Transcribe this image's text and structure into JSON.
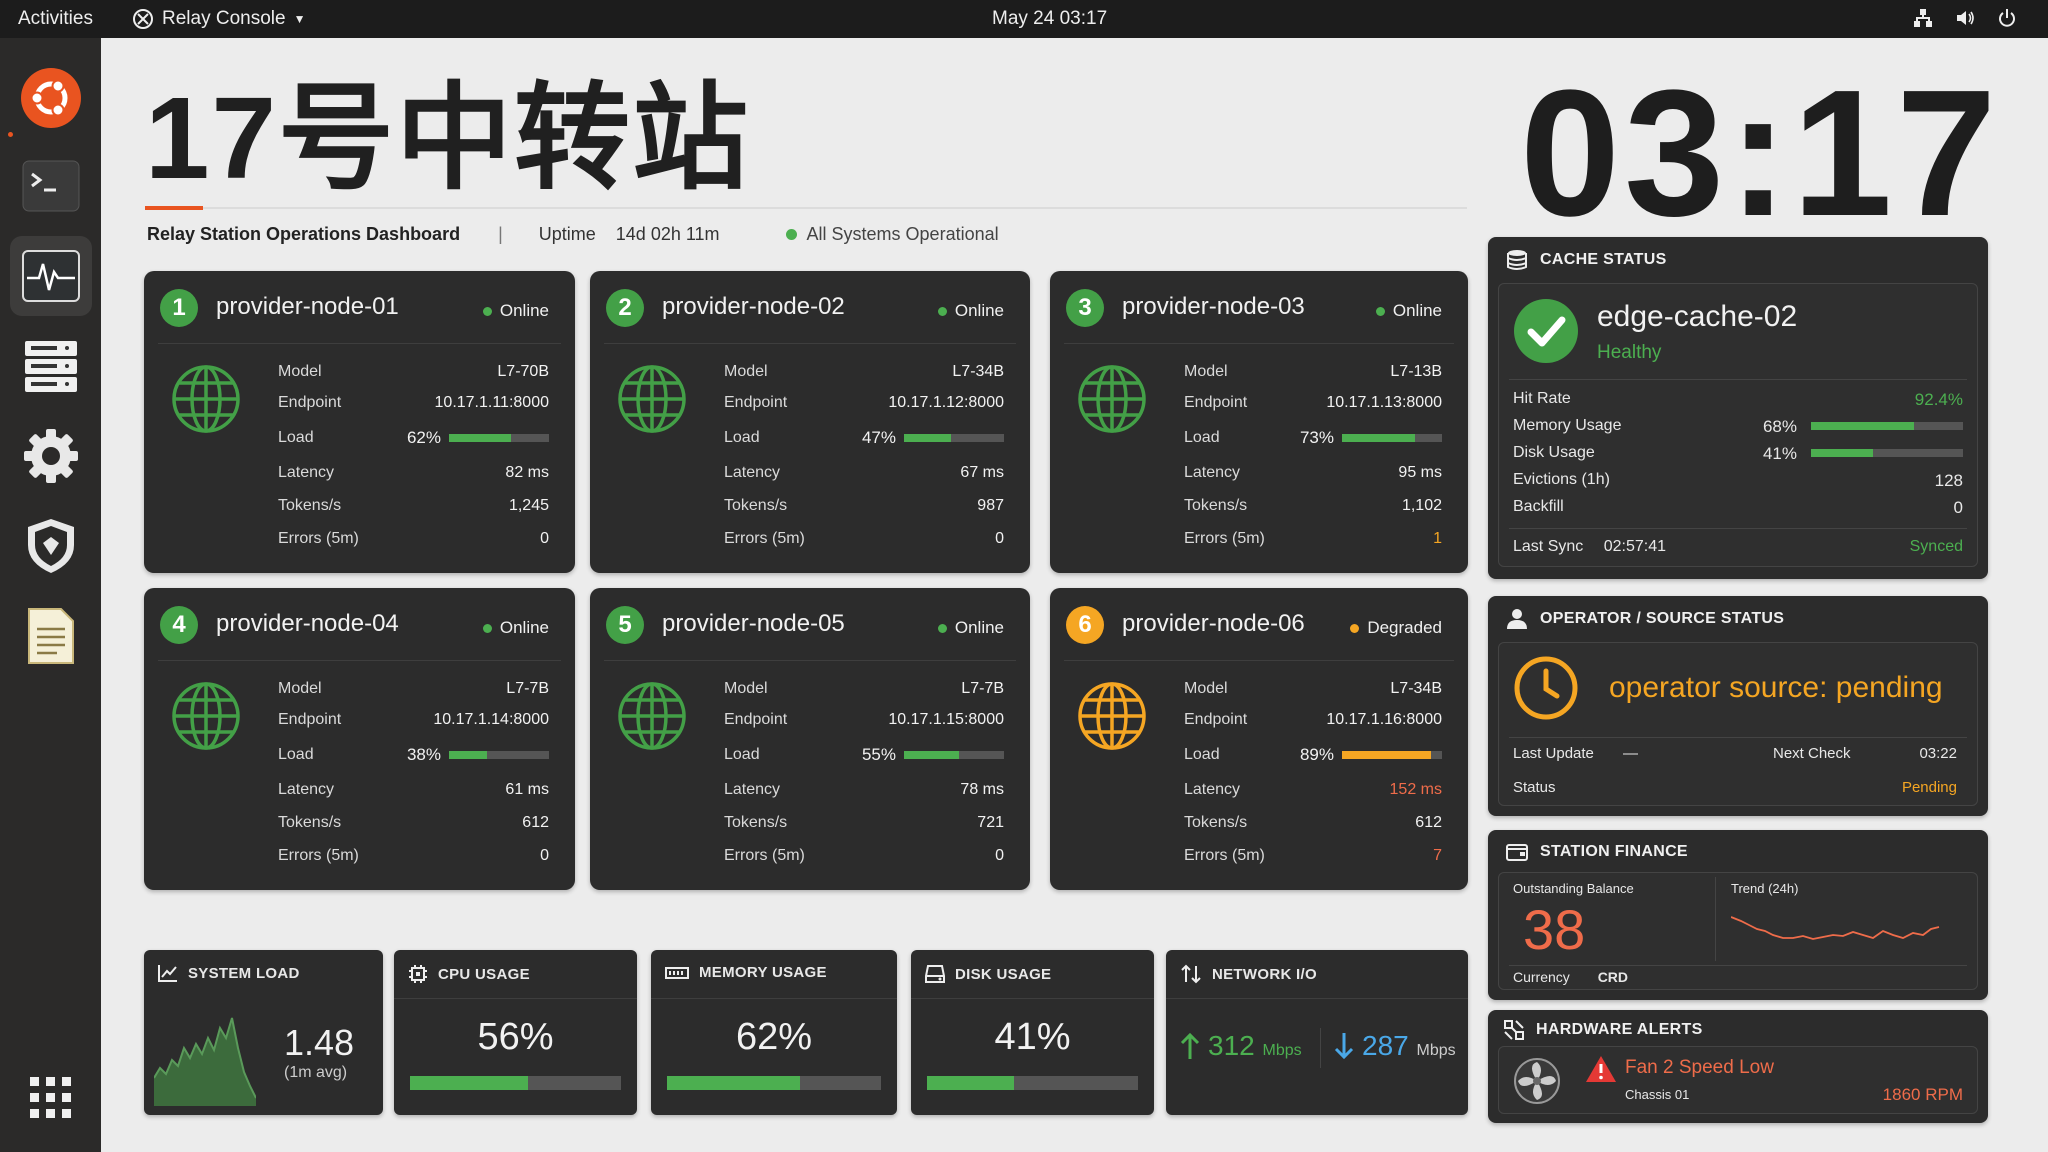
{
  "topbar": {
    "activities": "Activities",
    "app_name": "Relay Console",
    "datetime": "May 24  03:17"
  },
  "header": {
    "title": "17号中转站",
    "subtitle": "Relay Station Operations Dashboard",
    "separator": "|",
    "uptime_label": "Uptime",
    "uptime_value": "14d 02h 11m",
    "system_status": "All Systems Operational",
    "clock": "03:17"
  },
  "nodes": [
    {
      "num": "1",
      "name": "provider-node-01",
      "status": "Online",
      "model": "L7-70B",
      "endpoint": "10.17.1.11:8000",
      "load": "62%",
      "load_frac": 0.62,
      "latency": "82 ms",
      "tokens": "1,245",
      "errors": "0"
    },
    {
      "num": "2",
      "name": "provider-node-02",
      "status": "Online",
      "model": "L7-34B",
      "endpoint": "10.17.1.12:8000",
      "load": "47%",
      "load_frac": 0.47,
      "latency": "67 ms",
      "tokens": "987",
      "errors": "0"
    },
    {
      "num": "3",
      "name": "provider-node-03",
      "status": "Online",
      "model": "L7-13B",
      "endpoint": "10.17.1.13:8000",
      "load": "73%",
      "load_frac": 0.73,
      "latency": "95 ms",
      "tokens": "1,102",
      "errors": "1"
    },
    {
      "num": "4",
      "name": "provider-node-04",
      "status": "Online",
      "model": "L7-7B",
      "endpoint": "10.17.1.14:8000",
      "load": "38%",
      "load_frac": 0.38,
      "latency": "61 ms",
      "tokens": "612",
      "errors": "0"
    },
    {
      "num": "5",
      "name": "provider-node-05",
      "status": "Online",
      "model": "L7-7B",
      "endpoint": "10.17.1.15:8000",
      "load": "55%",
      "load_frac": 0.55,
      "latency": "78 ms",
      "tokens": "721",
      "errors": "0"
    },
    {
      "num": "6",
      "name": "provider-node-06",
      "status": "Degraded",
      "model": "L7-34B",
      "endpoint": "10.17.1.16:8000",
      "load": "89%",
      "load_frac": 0.89,
      "latency": "152 ms",
      "tokens": "612",
      "errors": "7"
    }
  ],
  "node_labels": {
    "model": "Model",
    "endpoint": "Endpoint",
    "load": "Load",
    "latency": "Latency",
    "tokens": "Tokens/s",
    "errors": "Errors (5m)"
  },
  "cache": {
    "title": "CACHE STATUS",
    "name": "edge-cache-02",
    "health": "Healthy",
    "hit_rate_label": "Hit Rate",
    "hit_rate": "92.4%",
    "memory_label": "Memory Usage",
    "memory": "68%",
    "memory_frac": 0.68,
    "disk_label": "Disk Usage",
    "disk": "41%",
    "disk_frac": 0.41,
    "evictions_label": "Evictions (1h)",
    "evictions": "128",
    "backfill_label": "Backfill",
    "backfill": "0",
    "last_sync_label": "Last Sync",
    "last_sync": "02:57:41",
    "sync_state": "Synced"
  },
  "operator": {
    "title": "OPERATOR / SOURCE STATUS",
    "message": "operator source: pending",
    "last_update_label": "Last Update",
    "last_update": "—",
    "next_check_label": "Next Check",
    "next_check": "03:22",
    "status_label": "Status",
    "status": "Pending"
  },
  "finance": {
    "title": "STATION FINANCE",
    "balance_label": "Outstanding Balance",
    "balance": "38",
    "trend_label": "Trend (24h)",
    "currency_label": "Currency",
    "currency": "CRD"
  },
  "alerts": {
    "title": "HARDWARE ALERTS",
    "alert": "Fan 2 Speed Low",
    "source": "Chassis 01",
    "value": "1860 RPM"
  },
  "tiles": {
    "system_load": {
      "title": "SYSTEM LOAD",
      "value": "1.48",
      "sub": "(1m avg)"
    },
    "cpu": {
      "title": "CPU USAGE",
      "value": "56%",
      "frac": 0.56
    },
    "memory": {
      "title": "MEMORY USAGE",
      "value": "62%",
      "frac": 0.62
    },
    "disk": {
      "title": "DISK USAGE",
      "value": "41%",
      "frac": 0.41
    },
    "network": {
      "title": "NETWORK I/O",
      "up": "312",
      "down": "287",
      "unit": "Mbps"
    }
  },
  "colors": {
    "accent": "#e95420",
    "ok": "#4caf50",
    "warn": "#f5a623",
    "bad": "#ef6c4a",
    "down": "#4aa8e8"
  }
}
